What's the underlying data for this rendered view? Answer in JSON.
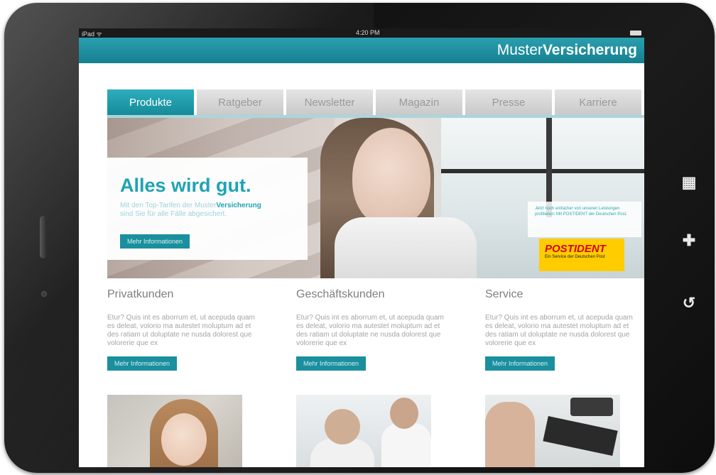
{
  "status_bar": {
    "carrier": "iPad ᯤ",
    "time": "4:20 PM"
  },
  "brand": {
    "light": "Muster",
    "bold": "Versicherung"
  },
  "nav": {
    "tabs": [
      {
        "label": "Produkte",
        "active": true
      },
      {
        "label": "Ratgeber"
      },
      {
        "label": "Newsletter"
      },
      {
        "label": "Magazin"
      },
      {
        "label": "Presse"
      },
      {
        "label": "Karriere"
      }
    ]
  },
  "hero": {
    "headline": "Alles wird gut.",
    "subline_prefix": "Mit den Top-Tarifen der Muster",
    "subline_brand": "Versicherung",
    "subline_suffix": "sind Sie für alle Fälle abgesichert.",
    "button_label": "Mehr Informationen",
    "postident_text": "Jetzt noch einfacher von unseren Leistungen profitieren: Mit POSTIDENT der Deutschen Post.",
    "postident_logo_post": "POST",
    "postident_logo_ident": "IDENT",
    "postident_claim": "Ein Service der Deutschen Post"
  },
  "columns": [
    {
      "heading": "Privatkunden",
      "text": "Etur? Quis int es aborrum et, ut acepuda quam es deleat, volorio ma autestet moluptum ad et des ratiam ut doluptate ne nusda dolorest que volorerie que ex",
      "button_label": "Mehr Informationen"
    },
    {
      "heading": "Geschäftskunden",
      "text": "Etur? Quis int es aborrum et, ut acepuda quam es deleat, volorio ma autestet moluptum ad et des ratiam ut doluptate ne nusda dolorest que volorerie que ex",
      "button_label": "Mehr Informationen"
    },
    {
      "heading": "Service",
      "text": "Etur? Quis int es aborrum et, ut acepuda quam es deleat, volorio ma autestet moluptum ad et des ratiam ut doluptate ne nusda dolorest que volorerie que ex",
      "button_label": "Mehr Informationen"
    }
  ],
  "device_icons": {
    "apps": "grid-icon",
    "puzzle": "puzzle-icon",
    "back": "back-arrow-icon"
  },
  "colors": {
    "accent": "#1fa3b5",
    "button": "#1a8f9e",
    "postident_yellow": "#ffcc00"
  }
}
